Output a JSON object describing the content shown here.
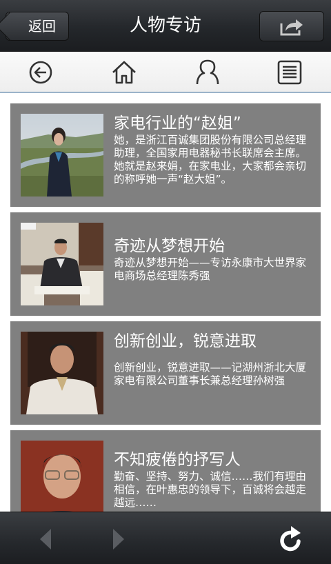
{
  "header": {
    "back_label": "返回",
    "title": "人物专访"
  },
  "toolbar": {
    "icons": [
      "back-circle-icon",
      "home-icon",
      "user-icon",
      "list-icon"
    ]
  },
  "articles": [
    {
      "title": "家电行业的“赵姐”",
      "description": "她，是浙江百诚集团股份有限公司总经理助理，全国家用电器秘书长联席会主席。她就是赵来娟，在家电业，大家都会亲切的称呼她一声“赵大姐”。"
    },
    {
      "title": "奇迹从梦想开始",
      "description": "奇迹从梦想开始——专访永康市大世界家电商场总经理陈秀强"
    },
    {
      "title": "创新创业，锐意进取",
      "description": "创新创业，锐意进取——记湖州浙北大厦家电有限公司董事长兼总经理孙树强"
    },
    {
      "title": "不知疲倦的抒写人",
      "description": "勤奋、坚持、努力、诚信……我们有理由相信，在叶惠忠的领导下，百诚将会越走越远……"
    }
  ],
  "bottom_bar": {
    "icons": [
      "prev-arrow-icon",
      "next-arrow-icon",
      "refresh-icon"
    ]
  },
  "colors": {
    "card_bg": "#808080",
    "bar_dark": "#24272b",
    "toolbar_bg": "#f2f2f2"
  }
}
